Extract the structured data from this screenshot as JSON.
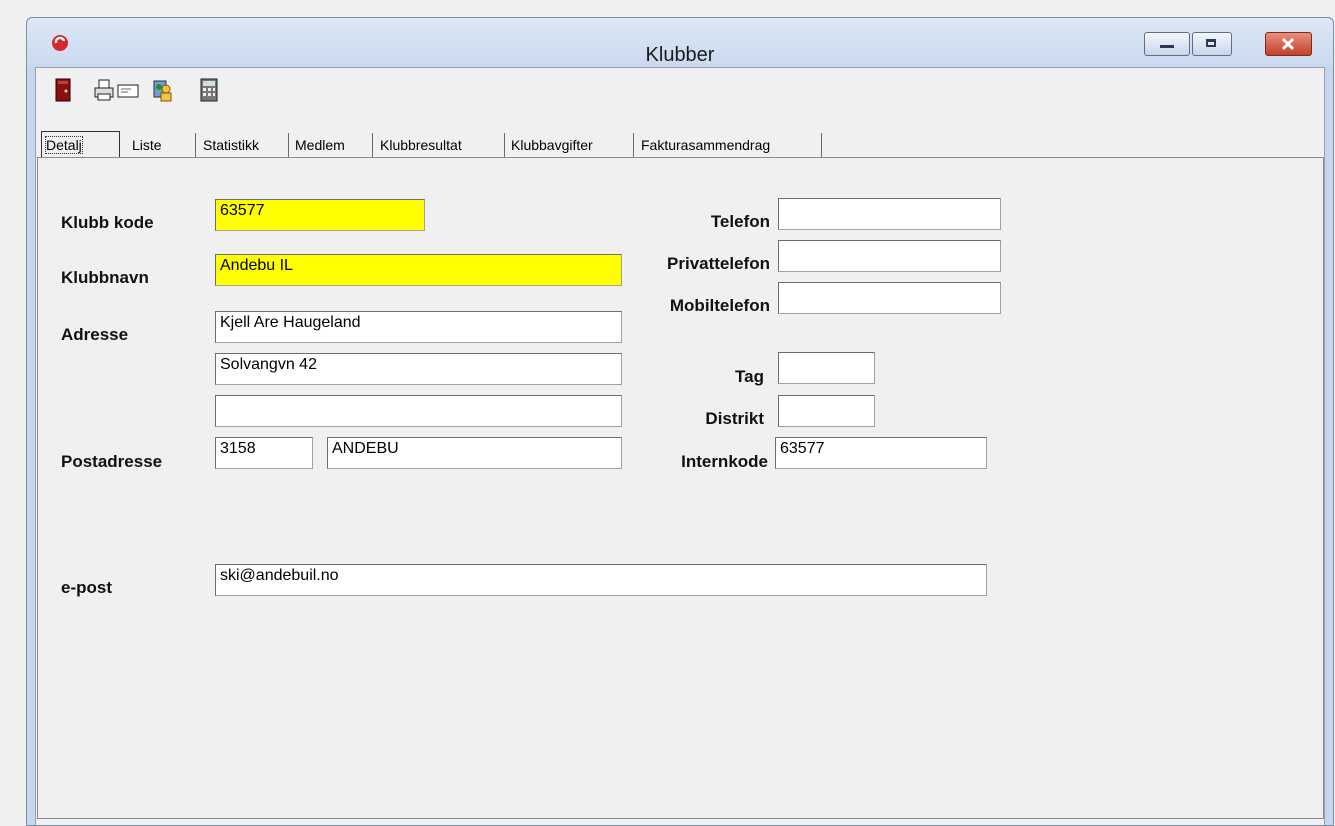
{
  "window": {
    "title": "Klubber"
  },
  "toolbar": {
    "icons": [
      "exit-icon",
      "print-icon",
      "card-icon",
      "users-icon",
      "calculator-icon"
    ]
  },
  "tabs": [
    {
      "label": "Detalj",
      "active": true
    },
    {
      "label": "Liste"
    },
    {
      "label": "Statistikk"
    },
    {
      "label": "Medlem"
    },
    {
      "label": "Klubbresultat"
    },
    {
      "label": "Klubbavgifter"
    },
    {
      "label": "Fakturasammendrag"
    }
  ],
  "form": {
    "klubb_kode_label": "Klubb kode",
    "klubb_kode_value": "63577",
    "klubbnavn_label": "Klubbnavn",
    "klubbnavn_value": "Andebu IL",
    "adresse_label": "Adresse",
    "adresse1_value": "Kjell Are Haugeland",
    "adresse2_value": "Solvangvn 42",
    "adresse3_value": "",
    "postadresse_label": "Postadresse",
    "postnr_value": "3158",
    "poststed_value": "ANDEBU",
    "epost_label": "e-post",
    "epost_value": "ski@andebuil.no",
    "telefon_label": "Telefon",
    "telefon_value": "",
    "privattelefon_label": "Privattelefon",
    "privattelefon_value": "",
    "mobiltelefon_label": "Mobiltelefon",
    "mobiltelefon_value": "",
    "tag_label": "Tag",
    "tag_value": "",
    "distrikt_label": "Distrikt",
    "distrikt_value": "",
    "internkode_label": "Internkode",
    "internkode_value": "63577"
  },
  "colors": {
    "required_field": "#ffff00",
    "title_bar": "#c9d9ee",
    "close_button": "#c4412a"
  }
}
